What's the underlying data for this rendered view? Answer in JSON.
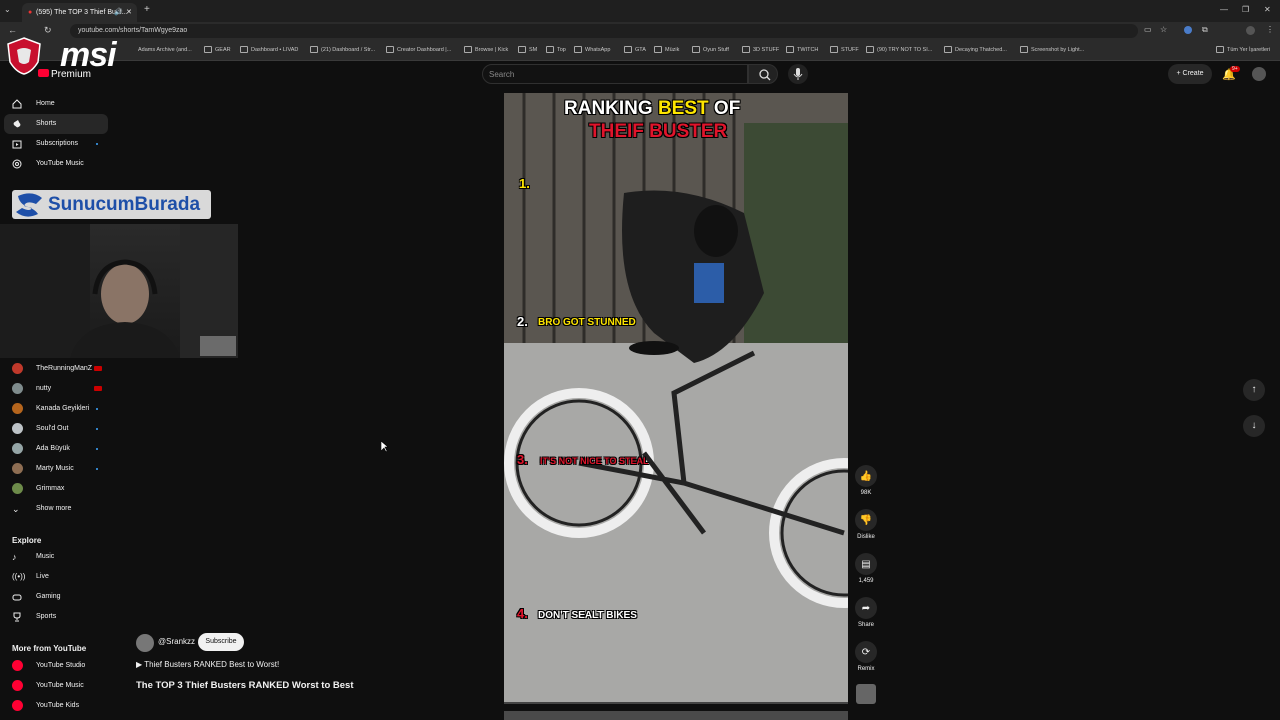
{
  "browser": {
    "tab_title": "(595) The TOP 3 Thief Bust...",
    "url": "youtube.com/shorts/TamWgye9zao",
    "bookmarks": [
      "Adams Archive (and...",
      "GEAR",
      "Dashboard • LIVAD",
      "(21) Dashboard / Str...",
      "Creator Dashboard |...",
      "Browse | Kick",
      "SM",
      "Top",
      "WhatsApp",
      "GTA",
      "Müzik",
      "Oyun Stuff",
      "3D STUFF",
      "TWITCH",
      "STUFF",
      "(90) TRY NOT TO SI...",
      "Decaying Thatched...",
      "Screenshot by Light...",
      "Tüm Yer İşaretleri"
    ]
  },
  "header": {
    "logo_text": "msi",
    "premium": "Premium",
    "search_placeholder": "Search",
    "create_label": "Create",
    "notification_count": "9+"
  },
  "sidebar": {
    "main": [
      {
        "label": "Home",
        "icon": "home-icon"
      },
      {
        "label": "Shorts",
        "icon": "shorts-icon"
      },
      {
        "label": "Subscriptions",
        "icon": "subscriptions-icon"
      },
      {
        "label": "YouTube Music",
        "icon": "music-icon"
      }
    ],
    "banner_text": "SunucumBurada",
    "subscriptions": [
      {
        "label": "TheRunningManZ",
        "live": true,
        "color": "#c0392b"
      },
      {
        "label": "nutty",
        "live": true,
        "color": "#7f8c8d"
      },
      {
        "label": "Kanada Geyikleri",
        "live": false,
        "color": "#b5651d"
      },
      {
        "label": "Soul'd Out",
        "live": false,
        "color": "#bdc3c7"
      },
      {
        "label": "Ada Büyük",
        "live": false,
        "color": "#95a5a6"
      },
      {
        "label": "Marty Music",
        "live": false,
        "color": "#8e6e53"
      },
      {
        "label": "Grimmax",
        "live": false,
        "color": "#6d8b4a"
      }
    ],
    "show_more": "Show more",
    "explore_title": "Explore",
    "explore": [
      {
        "label": "Music",
        "icon": "music-note-icon"
      },
      {
        "label": "Live",
        "icon": "live-icon"
      },
      {
        "label": "Gaming",
        "icon": "gaming-icon"
      },
      {
        "label": "Sports",
        "icon": "trophy-icon"
      }
    ],
    "more_title": "More from YouTube",
    "more": [
      {
        "label": "YouTube Studio"
      },
      {
        "label": "YouTube Music"
      },
      {
        "label": "YouTube Kids"
      }
    ]
  },
  "short": {
    "overlay_title_1": "RANKING",
    "overlay_title_2": "BEST",
    "overlay_title_3": "OF",
    "overlay_subtitle": "THEIF BUSTER",
    "rank1": "1.",
    "rank2": "2.",
    "rank2_text": "BRO GOT STUNNED",
    "rank3": "3.",
    "rank3_text": "IT'S NOT NICE TO STEAL",
    "rank4": "4.",
    "rank4_text": "DON'T SEALT BIKES",
    "progress": 0.0
  },
  "actions": {
    "likes": "98K",
    "dislike": "Dislike",
    "comments": "1,459",
    "share": "Share",
    "remix": "Remix"
  },
  "channel": {
    "handle": "@Srankzz",
    "subscribe": "Subscribe",
    "playlist": "▶ Thief Busters RANKED Best to Worst!",
    "title": "The TOP 3 Thief Busters RANKED Worst to Best"
  }
}
